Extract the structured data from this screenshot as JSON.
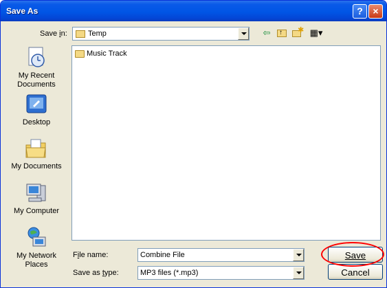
{
  "window": {
    "title": "Save As",
    "help_label": "?",
    "close_label": "×"
  },
  "save_in": {
    "label": "Save in:",
    "value": "Temp"
  },
  "toolbar": {
    "back": "⇦",
    "up": "↑",
    "new_folder": "✱",
    "view": "▦▾"
  },
  "places": [
    {
      "label": "My Recent Documents",
      "icon": "recent-documents-icon"
    },
    {
      "label": "Desktop",
      "icon": "desktop-icon"
    },
    {
      "label": "My Documents",
      "icon": "my-documents-icon"
    },
    {
      "label": "My Computer",
      "icon": "my-computer-icon"
    },
    {
      "label": "My Network Places",
      "icon": "network-places-icon"
    }
  ],
  "files": [
    {
      "name": "Music Track",
      "type": "folder"
    }
  ],
  "file_name": {
    "label": "File name:",
    "value": "Combine File"
  },
  "save_as_type": {
    "label": "Save as type:",
    "value": "MP3 files (*.mp3)"
  },
  "buttons": {
    "save": "Save",
    "cancel": "Cancel"
  },
  "colors": {
    "titlebar": "#0055e5",
    "dialog": "#ece9d8",
    "highlight": "#ff0000"
  }
}
